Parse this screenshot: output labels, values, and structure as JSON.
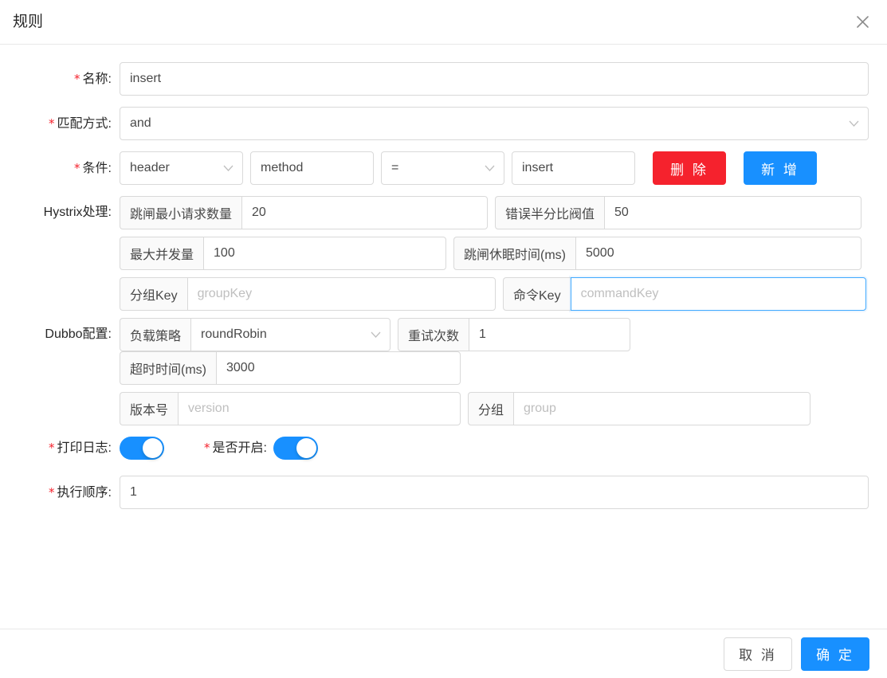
{
  "dialog": {
    "title": "规则",
    "close_icon": "close-icon"
  },
  "fields": {
    "name": {
      "label": "名称:",
      "value": "insert",
      "required": true
    },
    "match_mode": {
      "label": "匹配方式:",
      "value": "and",
      "required": true
    },
    "condition": {
      "label": "条件:",
      "required": true,
      "param_type": "header",
      "param_name": "method",
      "operator": "=",
      "param_value": "insert",
      "delete_label": "删 除",
      "add_label": "新 增"
    },
    "hystrix": {
      "label": "Hystrix处理:",
      "items": [
        {
          "addon": "跳闸最小请求数量",
          "value": "20",
          "placeholder": ""
        },
        {
          "addon": "错误半分比阀值",
          "value": "50",
          "placeholder": ""
        },
        {
          "addon": "最大并发量",
          "value": "100",
          "placeholder": ""
        },
        {
          "addon": "跳闸休眠时间(ms)",
          "value": "5000",
          "placeholder": ""
        },
        {
          "addon": "分组Key",
          "value": "",
          "placeholder": "groupKey"
        },
        {
          "addon": "命令Key",
          "value": "",
          "placeholder": "commandKey",
          "focused": true
        }
      ]
    },
    "dubbo": {
      "label": "Dubbo配置:",
      "items": [
        {
          "addon": "负载策略",
          "value": "roundRobin",
          "placeholder": "",
          "select": true
        },
        {
          "addon": "重试次数",
          "value": "1",
          "placeholder": ""
        },
        {
          "addon": "超时时间(ms)",
          "value": "3000",
          "placeholder": ""
        },
        {
          "addon": "版本号",
          "value": "",
          "placeholder": "version"
        },
        {
          "addon": "分组",
          "value": "",
          "placeholder": "group"
        }
      ]
    },
    "print_log": {
      "label": "打印日志:",
      "required": true,
      "on": true
    },
    "enabled": {
      "label": "是否开启:",
      "required": true,
      "on": true
    },
    "exec_order": {
      "label": "执行顺序:",
      "value": "1",
      "required": true
    }
  },
  "footer": {
    "cancel_label": "取 消",
    "confirm_label": "确 定"
  },
  "colors": {
    "primary": "#1890ff",
    "danger": "#f5222d",
    "required_star": "#f5222d",
    "border": "#d9d9d9",
    "addon_bg": "#fafafa"
  }
}
